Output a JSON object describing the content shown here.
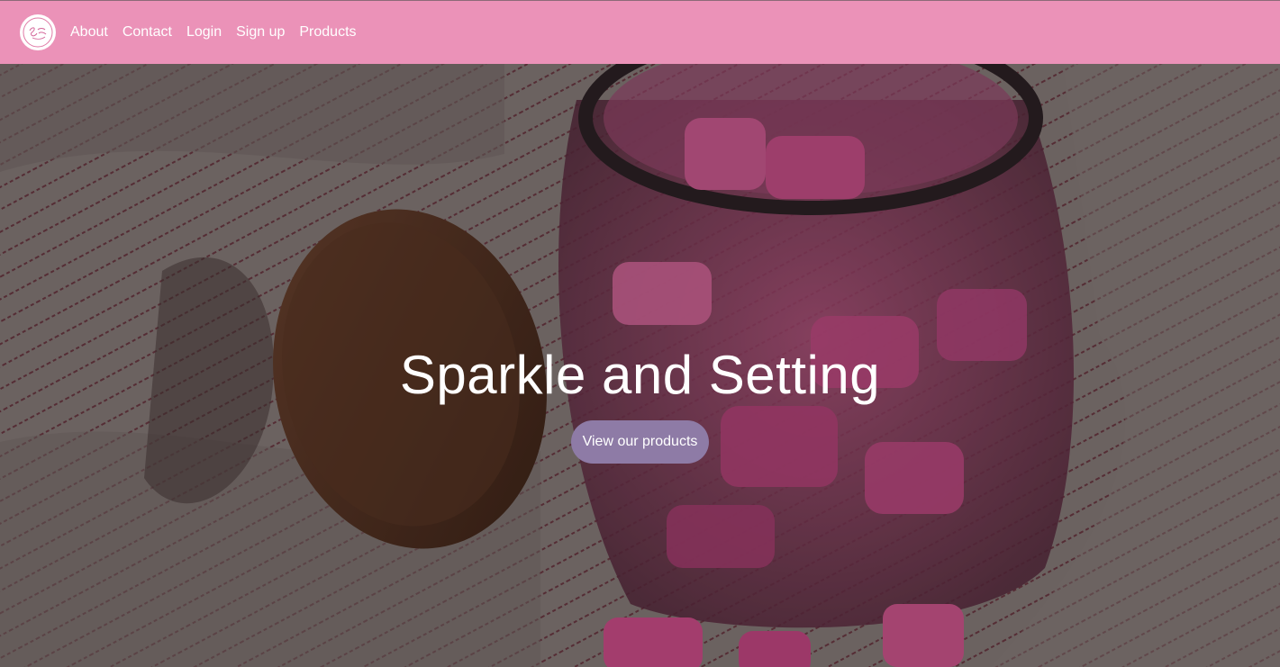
{
  "nav": {
    "logo_icon": "sparkle-and-setting-logo",
    "links": [
      "About",
      "Contact",
      "Login",
      "Sign up",
      "Products"
    ]
  },
  "hero": {
    "title": "Sparkle and Setting",
    "button_label": "View our products",
    "background_image": "pink-wax-melts-in-glass-jar"
  },
  "colors": {
    "navbar": "#eb92b8",
    "button": "#8e7ba6",
    "text": "#ffffff"
  }
}
